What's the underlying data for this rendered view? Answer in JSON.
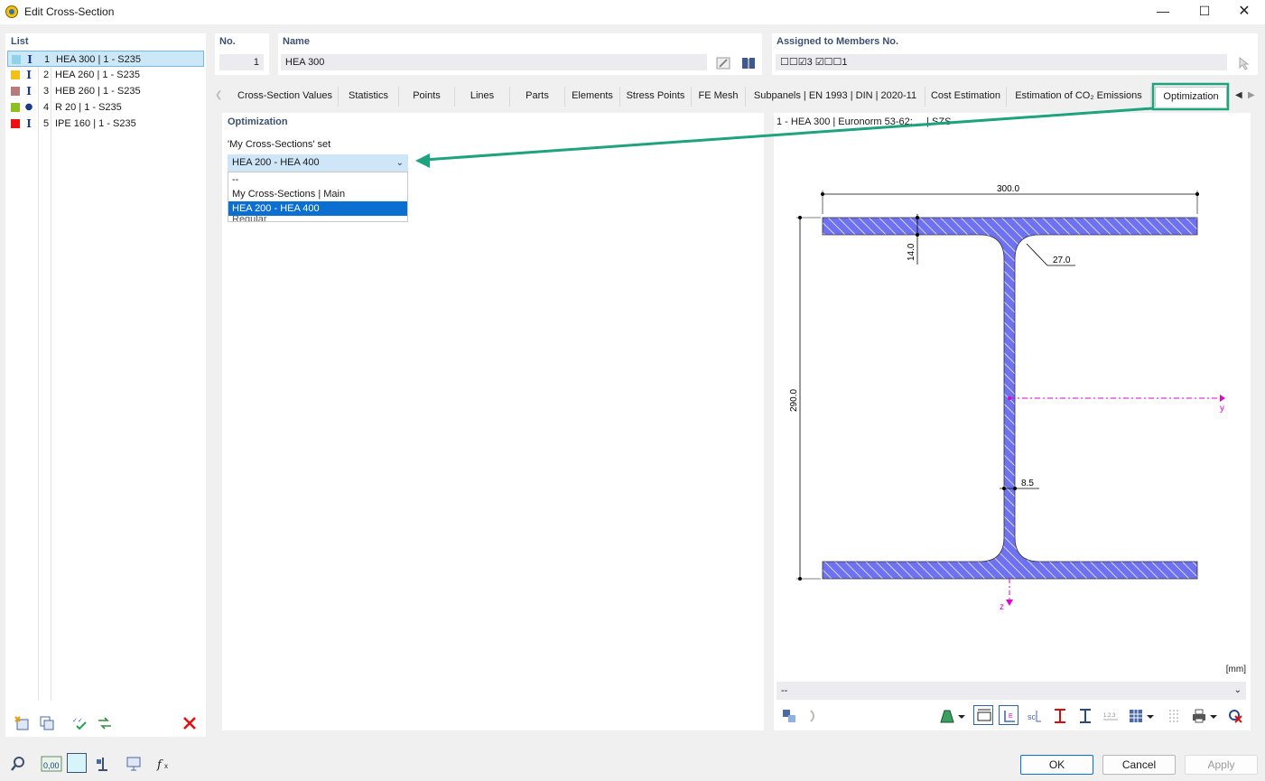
{
  "window": {
    "title": "Edit Cross-Section"
  },
  "list": {
    "header": "List",
    "items": [
      {
        "num": "1",
        "label": "HEA 300 | 1 - S235",
        "color": "#8fd3e8",
        "shape": "I-section-icon"
      },
      {
        "num": "2",
        "label": "HEA 260 | 1 - S235",
        "color": "#f3c01a",
        "shape": "I-section-icon"
      },
      {
        "num": "3",
        "label": "HEB 260 | 1 - S235",
        "color": "#b97c7c",
        "shape": "I-section-icon"
      },
      {
        "num": "4",
        "label": "R 20 | 1 - S235",
        "color": "#8cc020",
        "shape": "round-bar-icon"
      },
      {
        "num": "5",
        "label": "IPE 160 | 1 - S235",
        "color": "#ee1010",
        "shape": "I-section-icon"
      }
    ]
  },
  "no_field": {
    "label": "No.",
    "value": "1"
  },
  "name_field": {
    "label": "Name",
    "value": "HEA 300"
  },
  "assigned": {
    "label": "Assigned to Members No.",
    "value": "☐☐☑3  ☑☐☐1"
  },
  "tabs": [
    "Cross-Section Values",
    "Statistics",
    "Points",
    "Lines",
    "Parts",
    "Elements",
    "Stress Points",
    "FE Mesh",
    "Subpanels | EN 1993 | DIN | 2020-11",
    "Cost Estimation",
    "Estimation of CO₂ Emissions",
    "Optimization"
  ],
  "optimization": {
    "header": "Optimization",
    "set_label": "'My Cross-Sections' set",
    "selected": "HEA 200 - HEA 400",
    "options": [
      "--",
      "My Cross-Sections | Main",
      "HEA 200 - HEA 400",
      "Regular"
    ]
  },
  "drawing": {
    "caption": "1 - HEA 300 | Euronorm 53-62; ... | SZS",
    "dims": {
      "width": "300.0",
      "height": "290.0",
      "flange": "14.0",
      "radius": "27.0",
      "web": "8.5"
    },
    "axis_y": "y",
    "axis_z": "z",
    "unit": "[mm]",
    "combo_value": "--"
  },
  "buttons": {
    "ok": "OK",
    "cancel": "Cancel",
    "apply": "Apply"
  },
  "colors": {
    "accent": "#0a6fd1",
    "highlight": "#1fa37e",
    "section_fill": "#6f72f0",
    "axis": "#e000d0"
  }
}
